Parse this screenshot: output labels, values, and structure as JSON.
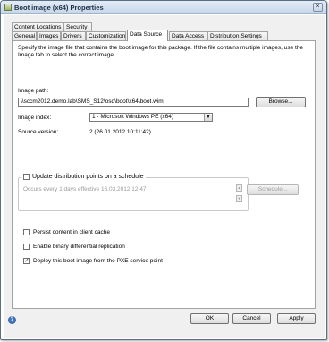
{
  "window": {
    "title": "Boot image (x64) Properties",
    "close_glyph": "×"
  },
  "tabs_row1": [
    "Content Locations",
    "Security"
  ],
  "tabs_row2": [
    "General",
    "Images",
    "Drivers",
    "Customization",
    "Data Source",
    "Data Access",
    "Distribution Settings"
  ],
  "active_tab": "Data Source",
  "description": "Specify the image file that contains the boot image for this package. If the file contains multiple images, use the Image tab to select the correct image.",
  "image_path": {
    "label": "Image path:",
    "value": "\\\\sccm2012.demo.lab\\SMS_S12\\osd\\boot\\x64\\boot.wim",
    "browse_label": "Browse..."
  },
  "image_index": {
    "label": "Image index:",
    "value": "1 - Microsoft Windows PE (x64)"
  },
  "source_version": {
    "label": "Source version:",
    "value": "2 (26.01.2012 10:11:42)"
  },
  "schedule": {
    "checkbox_label": "Update distribution points on a schedule",
    "checked": false,
    "occurs_text": "Occurs every 1 days effective 16.03.2012 12:47",
    "button_label": "Schedule..."
  },
  "options": [
    {
      "label": "Persist content in client cache",
      "checked": false
    },
    {
      "label": "Enable binary differential replication",
      "checked": false
    },
    {
      "label": "Deploy this boot image from the PXE service point",
      "checked": true
    }
  ],
  "footer": {
    "help_glyph": "?",
    "ok": "OK",
    "cancel": "Cancel",
    "apply": "Apply"
  }
}
